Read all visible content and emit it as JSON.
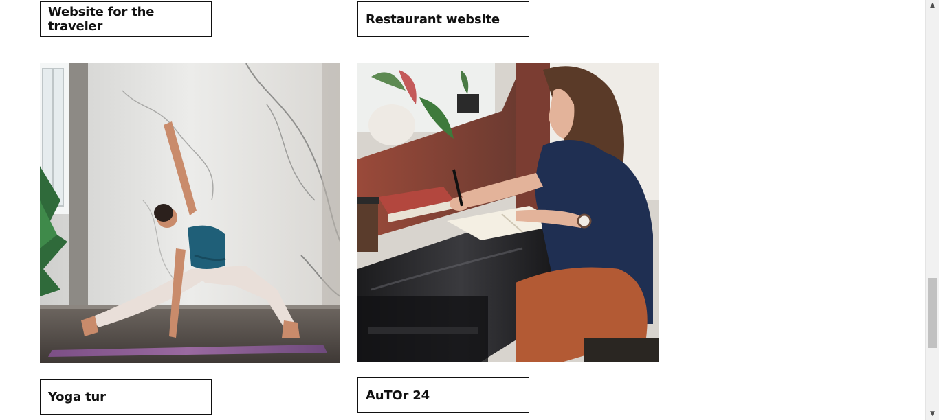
{
  "projects": [
    {
      "label": "Website for the traveler",
      "image": ""
    },
    {
      "label": "Restaurant website",
      "image": ""
    },
    {
      "label": "Yoga tur",
      "image": "yoga-photo"
    },
    {
      "label": "AuTOr 24",
      "image": "writing-photo"
    }
  ],
  "scrollbar": {
    "up_icon": "arrow-up-icon",
    "down_icon": "arrow-down-icon"
  }
}
